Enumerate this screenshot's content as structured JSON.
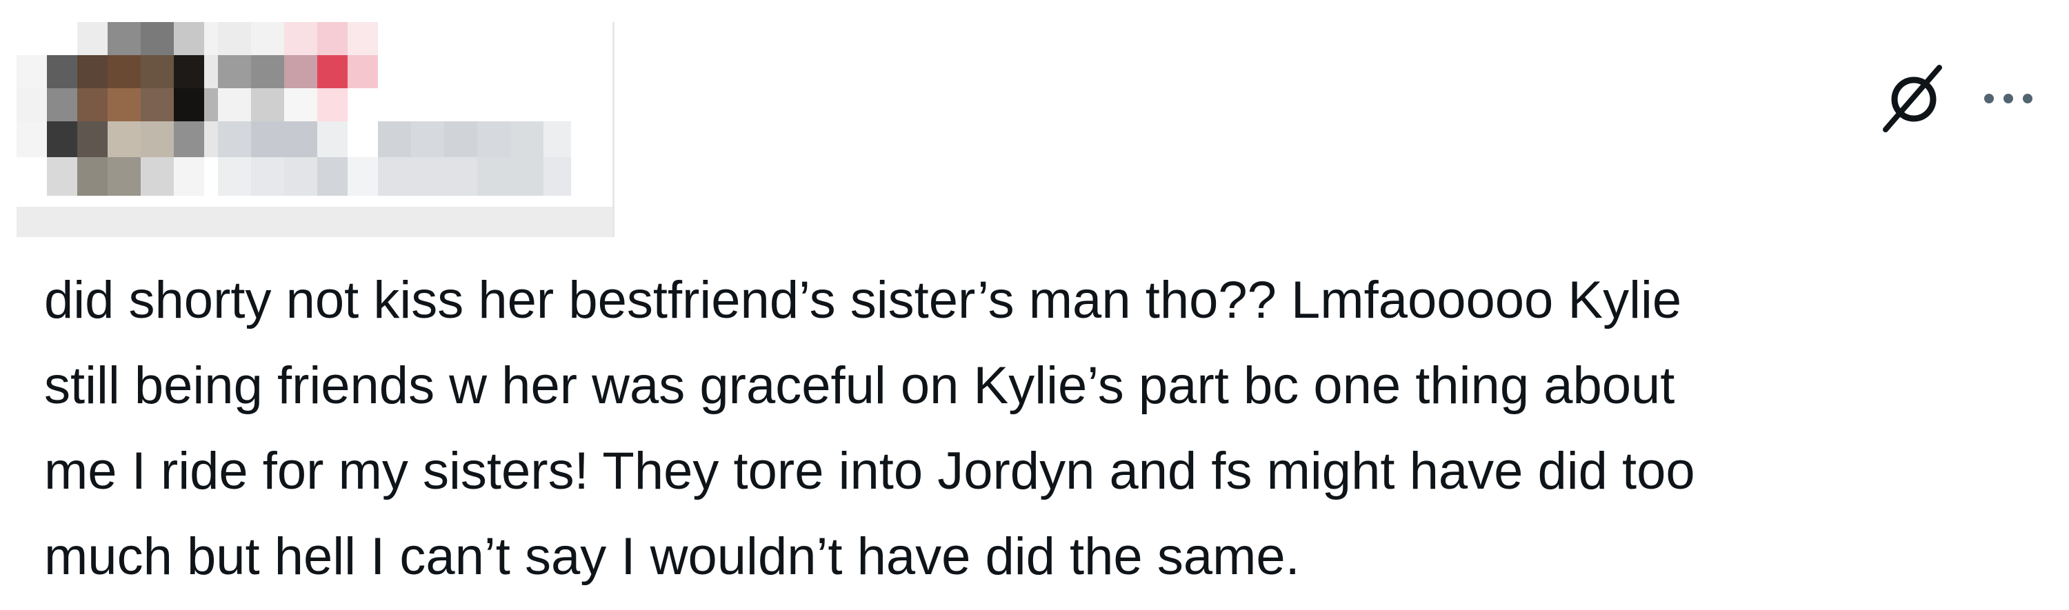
{
  "post": {
    "icons": {
      "grok": "grok-slashed-circle-icon",
      "more": "more-options-icon"
    },
    "text": "did shorty not kiss her bestfriend’s sister’s man tho?? Lmfaooooo Kylie\nstill being friends w her was graceful on Kylie’s part bc one thing about\nme I ride for my sisters! They tore into Jordyn and fs might have did too\nmuch but hell I can’t say I wouldn’t have did the same."
  },
  "colors": {
    "text": "#0f1419",
    "icon": "#0f1419",
    "divider": "#e6e6e6",
    "accent_pixel": "#e0465a"
  }
}
